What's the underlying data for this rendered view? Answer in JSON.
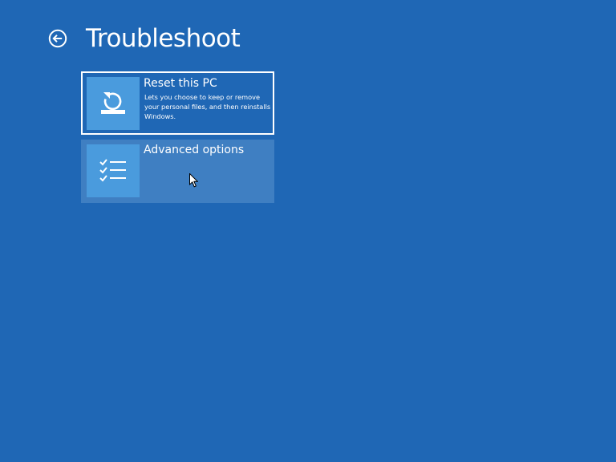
{
  "header": {
    "title": "Troubleshoot",
    "back_icon": "back-arrow-circle-icon"
  },
  "options": [
    {
      "title": "Reset this PC",
      "description": "Lets you choose to keep or remove your personal files, and then reinstalls Windows.",
      "icon": "reset-pc-icon",
      "selected": true
    },
    {
      "title": "Advanced options",
      "description": "",
      "icon": "checklist-icon",
      "hovered": true
    }
  ],
  "colors": {
    "background": "#1f67b5",
    "tile_icon_bg": "#4a9bdd",
    "tile_hover_bg": "#3f7fc2",
    "text": "#ffffff"
  }
}
